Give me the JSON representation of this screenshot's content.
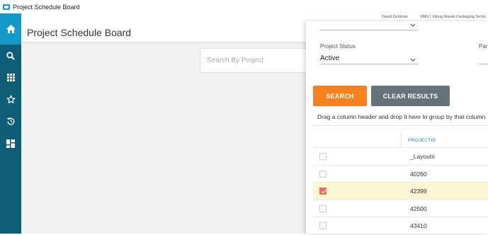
{
  "window": {
    "title": "Project Schedule Board"
  },
  "rail": {
    "items": [
      {
        "name": "home",
        "icon": "home-icon",
        "active": true
      },
      {
        "name": "search",
        "icon": "search-icon",
        "active": false
      },
      {
        "name": "apps",
        "icon": "apps-grid-icon",
        "active": false
      },
      {
        "name": "favorites",
        "icon": "star-icon",
        "active": false
      },
      {
        "name": "history",
        "icon": "history-icon",
        "active": false
      },
      {
        "name": "dashboard",
        "icon": "dashboard-icon",
        "active": false
      }
    ]
  },
  "header": {
    "title": "Project Schedule Board",
    "user": "David Dortman",
    "company": "VMG | Viking Masek Packaging Techn"
  },
  "search": {
    "placeholder": "Search By Project",
    "value": ""
  },
  "filters": {
    "status_label": "Project Status",
    "status_value": "Active",
    "part_label": "Part"
  },
  "buttons": {
    "search": "SEARCH",
    "clear": "CLEAR RESULTS"
  },
  "group_bar": {
    "text": "Drag a column header and drop it here to group by that column"
  },
  "grid": {
    "column": "PROJECTID",
    "rows": [
      {
        "id": "_Layouts",
        "checked": false
      },
      {
        "id": "40260",
        "checked": false
      },
      {
        "id": "42399",
        "checked": true
      },
      {
        "id": "42500",
        "checked": false
      },
      {
        "id": "43410",
        "checked": false
      }
    ]
  },
  "colors": {
    "rail": "#0e5e78",
    "rail_active": "#1599c9",
    "search_button": "#f5821f",
    "clear_button": "#66727a",
    "selected_row": "#fdf6d3",
    "checkbox_checked": "#ef6b5b",
    "column_header": "#1a7fa8"
  }
}
